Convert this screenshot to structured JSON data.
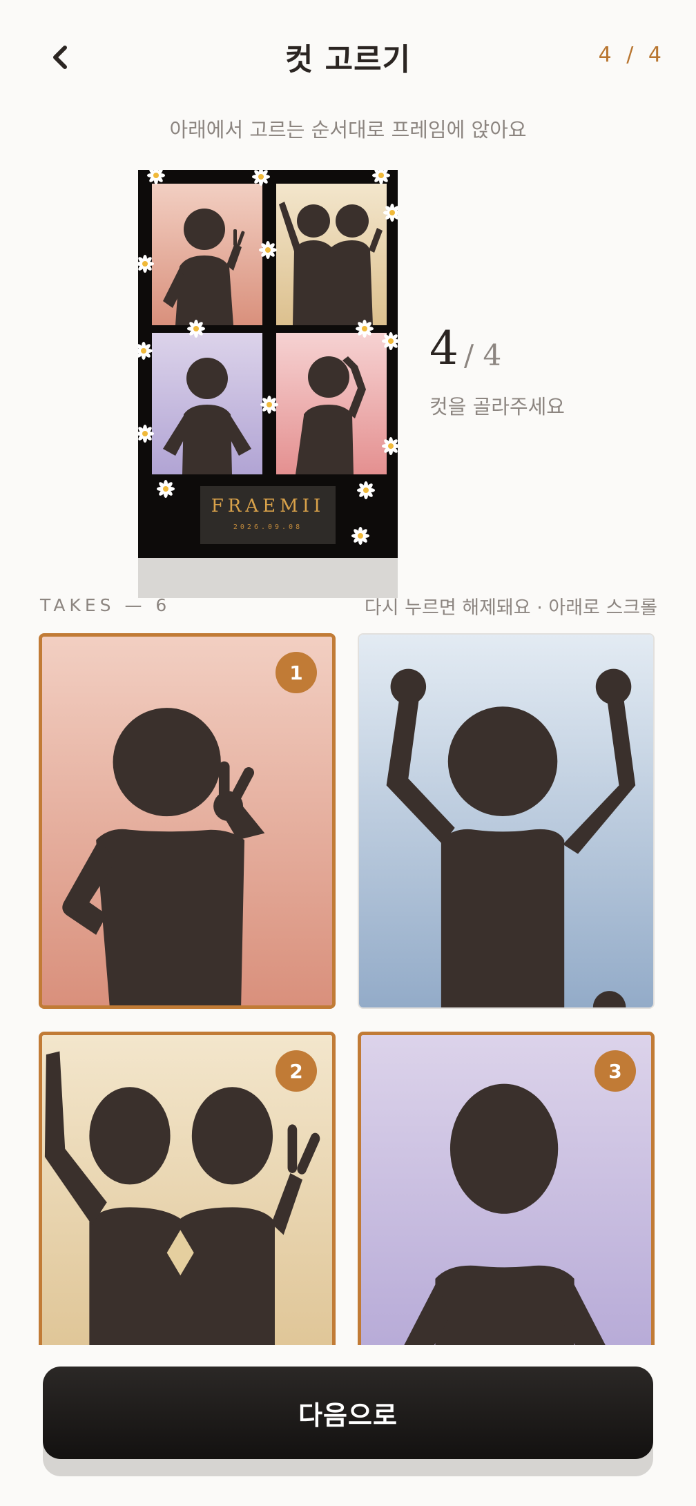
{
  "header": {
    "title": "컷 고르기",
    "step": "4 / 4",
    "subtitle": "아래에서 고르는 순서대로 프레임에 앉아요"
  },
  "frame": {
    "brand": "FRAEMII",
    "date": "2026.09.08",
    "selected_count": "4",
    "total": "/ 4",
    "hint": "컷을 골라주세요"
  },
  "takes_section": {
    "label": "TAKES — 6",
    "hint": "다시 누르면 해제돼요 · 아래로 스크롤"
  },
  "takes": [
    {
      "id": "take-1",
      "selected": true,
      "order": "1",
      "bg": "peach"
    },
    {
      "id": "take-2",
      "selected": false,
      "order": "",
      "bg": "blue"
    },
    {
      "id": "take-3",
      "selected": true,
      "order": "2",
      "bg": "cream"
    },
    {
      "id": "take-4",
      "selected": true,
      "order": "3",
      "bg": "lavender"
    }
  ],
  "colors": {
    "accent": "#c17b36",
    "background": "#fbfaf8",
    "silhouette": "#3a302c",
    "button": "#161413"
  },
  "actions": {
    "next_label": "다음으로"
  }
}
